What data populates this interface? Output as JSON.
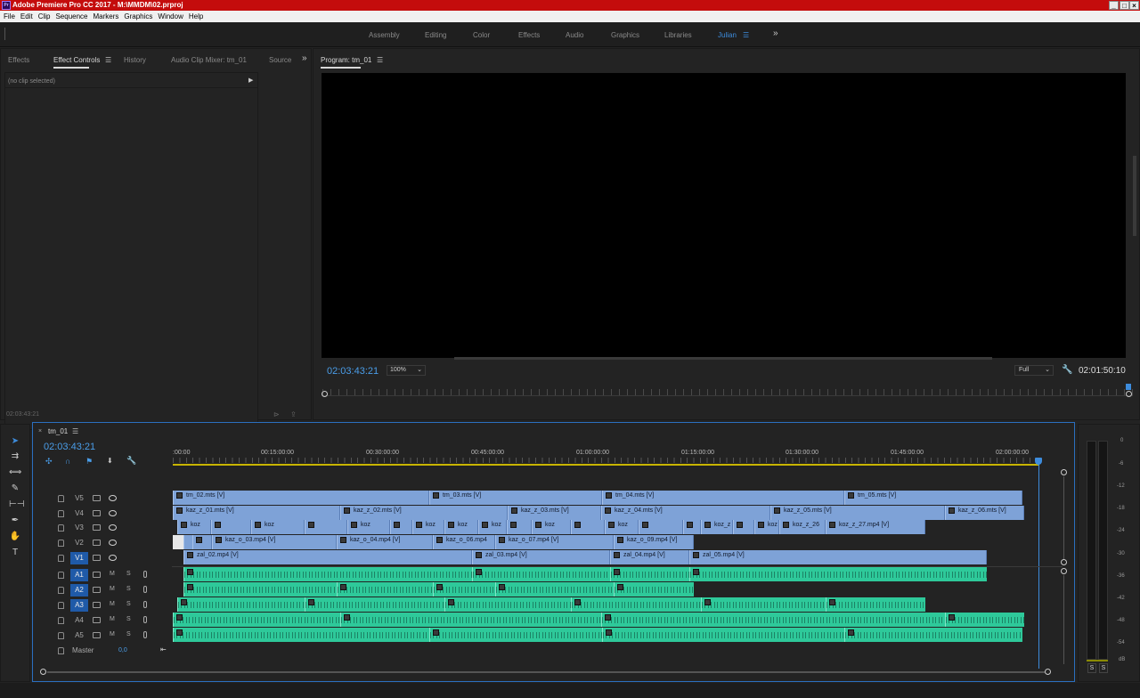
{
  "app": {
    "title": "Adobe Premiere Pro CC 2017 - M:\\MMDM\\02.prproj"
  },
  "menu": [
    "File",
    "Edit",
    "Clip",
    "Sequence",
    "Markers",
    "Graphics",
    "Window",
    "Help"
  ],
  "workspaces": [
    {
      "label": "Assembly"
    },
    {
      "label": "Editing"
    },
    {
      "label": "Color"
    },
    {
      "label": "Effects"
    },
    {
      "label": "Audio"
    },
    {
      "label": "Graphics"
    },
    {
      "label": "Libraries"
    },
    {
      "label": "Julian",
      "active": true
    }
  ],
  "left_panel": {
    "tabs": [
      "Effects",
      "Effect Controls",
      "History",
      "Audio Clip Mixer: tm_01",
      "Source"
    ],
    "active_tab": "Effect Controls",
    "no_clip": "(no clip selected)",
    "timecode": "02:03:43:21"
  },
  "program": {
    "tab": "Program: tm_01",
    "timecode": "02:03:43:21",
    "zoom": "100%",
    "quality": "Full",
    "duration": "02:01:50:10"
  },
  "timeline": {
    "tab": "tm_01",
    "timecode": "02:03:43:21",
    "ruler": [
      ":00:00",
      "00:15:00:00",
      "00:30:00:00",
      "00:45:00:00",
      "01:00:00:00",
      "01:15:00:00",
      "01:30:00:00",
      "01:45:00:00",
      "02:00:00:00"
    ],
    "tracks": [
      {
        "name": "V5",
        "type": "video"
      },
      {
        "name": "V4",
        "type": "video"
      },
      {
        "name": "V3",
        "type": "video"
      },
      {
        "name": "V2",
        "type": "video"
      },
      {
        "name": "V1",
        "type": "video",
        "target": true
      },
      {
        "name": "A1",
        "type": "audio",
        "target": true
      },
      {
        "name": "A2",
        "type": "audio",
        "target": true
      },
      {
        "name": "A3",
        "type": "audio",
        "target": true
      },
      {
        "name": "A4",
        "type": "audio"
      },
      {
        "name": "A5",
        "type": "audio"
      }
    ],
    "master": {
      "label": "Master",
      "value": "0,0"
    },
    "clip_labels": {
      "V5": [
        "tm_02.mts [V]",
        "tm_03.mts [V]",
        "tm_04.mts [V]",
        "tm_05.mts [V]"
      ],
      "V4": [
        "kaz_z_01.mts [V]",
        "kaz_z_02.mts [V]",
        "kaz_z_03.mts [V]",
        "kaz_z_04.mts [V]",
        "kaz_z_05.mts [V]",
        "kaz_z_06.mts [V]"
      ],
      "V3": [
        "koz",
        "koz",
        "koz",
        "koz",
        "koz",
        "koz",
        "koz",
        "koz",
        "koz",
        "koz_z",
        "koz",
        "koz_z_26",
        "koz_z_27.mp4 [V]"
      ],
      "V2": [
        "kaz_o_03.mp4 [V]",
        "kaz_o_04.mp4 [V]",
        "kaz_o_06.mp4",
        "kaz_o_07.mp4 [V]",
        "kaz_o_09.mp4 [V]"
      ],
      "V1": [
        "zal_02.mp4 [V]",
        "zal_03.mp4 [V]",
        "zal_04.mp4 [V]",
        "zal_05.mp4 [V]"
      ]
    }
  },
  "meter": {
    "scale": [
      "0",
      "-6",
      "-12",
      "-18",
      "-24",
      "-30",
      "-36",
      "-42",
      "-48",
      "-54",
      "dB"
    ],
    "solo": [
      "S",
      "S"
    ]
  }
}
